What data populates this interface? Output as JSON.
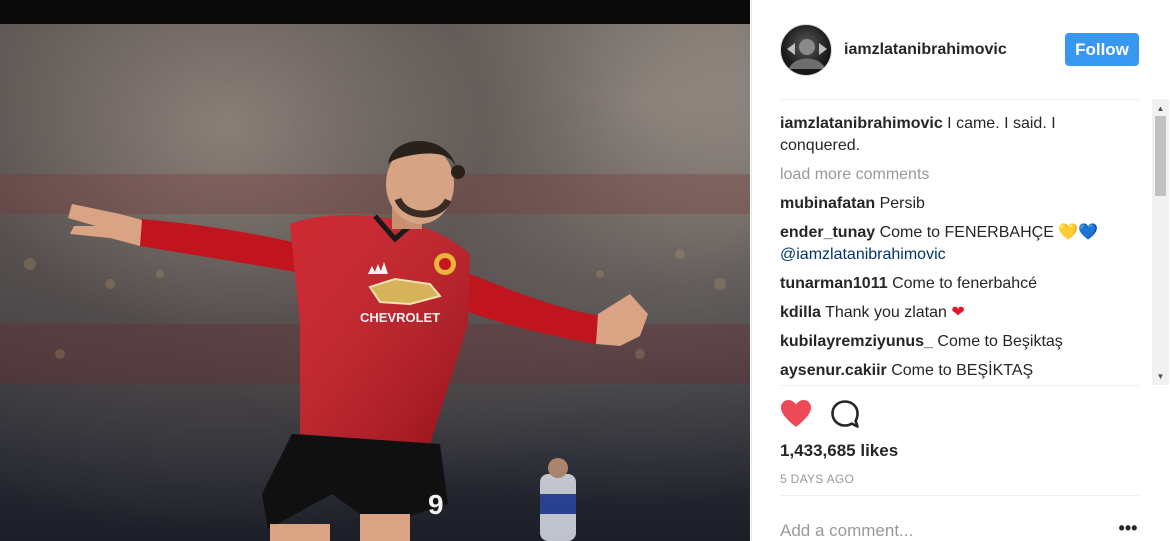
{
  "post": {
    "username": "iamzlatanibrahimovic",
    "follow_label": "Follow",
    "caption": {
      "user": "iamzlatanibrahimovic",
      "text": "I came. I said. I conquered."
    },
    "load_more_label": "load more comments",
    "comments": [
      {
        "user": "mubinafatan",
        "text": "Persib"
      },
      {
        "user": "ender_tunay",
        "text": "Come to FENERBAHÇE",
        "emojis": [
          "💛",
          "💙"
        ],
        "mention": "@iamzlatanibrahimovic"
      },
      {
        "user": "tunarman1011",
        "text": "Come to fenerbahcé"
      },
      {
        "user": "kdilla",
        "text": "Thank you zlatan",
        "emojis": [
          "❤"
        ]
      },
      {
        "user": "kubilayremziyunus_",
        "text": "Come to Beşiktaş"
      },
      {
        "user": "aysenur.cakiir",
        "text": "Come to BEŞİKTAŞ"
      }
    ],
    "likes": "1,433,685 likes",
    "timestamp": "5 DAYS AGO",
    "add_comment_placeholder": "Add a comment...",
    "more_label": "•••"
  },
  "icons": {
    "like": "heart-icon",
    "comment": "comment-bubble-icon",
    "more": "more-options-icon"
  },
  "colors": {
    "follow_button": "#3897f0",
    "like_heart": "#ed4956",
    "secondary_text": "#999999"
  },
  "photo": {
    "shirt_sponsor": "CHEVROLET",
    "shirt_number": "9"
  }
}
